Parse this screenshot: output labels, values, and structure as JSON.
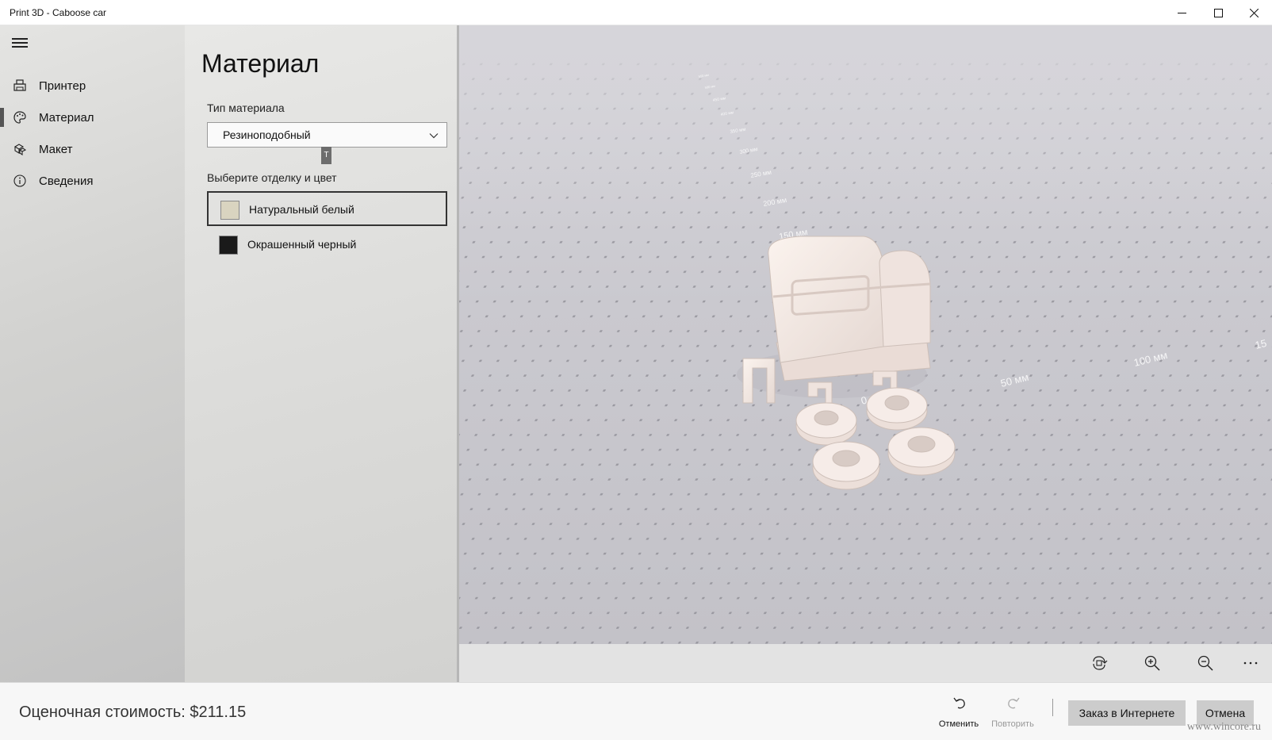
{
  "window": {
    "title": "Print 3D - Caboose car"
  },
  "nav": {
    "items": [
      {
        "label": "Принтер",
        "icon": "printer-icon"
      },
      {
        "label": "Материал",
        "icon": "palette-icon",
        "selected": true
      },
      {
        "label": "Макет",
        "icon": "layout-icon"
      },
      {
        "label": "Сведения",
        "icon": "info-icon"
      }
    ]
  },
  "panel": {
    "heading": "Материал",
    "material_type_label": "Тип материала",
    "material_type_value": "Резиноподобный",
    "cursor_tip": "T",
    "finish_label": "Выберите отделку и цвет",
    "finishes": [
      {
        "label": "Натуральный белый",
        "color": "#d9d4c0",
        "selected": true
      },
      {
        "label": "Окрашенный черный",
        "color": "#1a1a1a",
        "selected": false
      }
    ]
  },
  "viewport": {
    "ruler_labels": [
      "150 мм",
      "200 мм",
      "250 мм",
      "300 мм",
      "350 мм",
      "400 мм",
      "450 мм",
      "500 мм",
      "550 мм"
    ],
    "x_labels": [
      "0 мм",
      "50 мм",
      "100 мм",
      "15"
    ],
    "model_color": "#f2e7e2"
  },
  "toolbar3d": {
    "buttons": [
      "reset-view-icon",
      "zoom-in-icon",
      "zoom-out-icon",
      "more-icon"
    ]
  },
  "bottom": {
    "cost": "Оценочная стоимость: $211.15",
    "undo_label": "Отменить",
    "redo_label": "Повторить",
    "order_online": "Заказ в Интернете",
    "cancel": "Отмена",
    "watermark": "www.wincore.ru"
  }
}
